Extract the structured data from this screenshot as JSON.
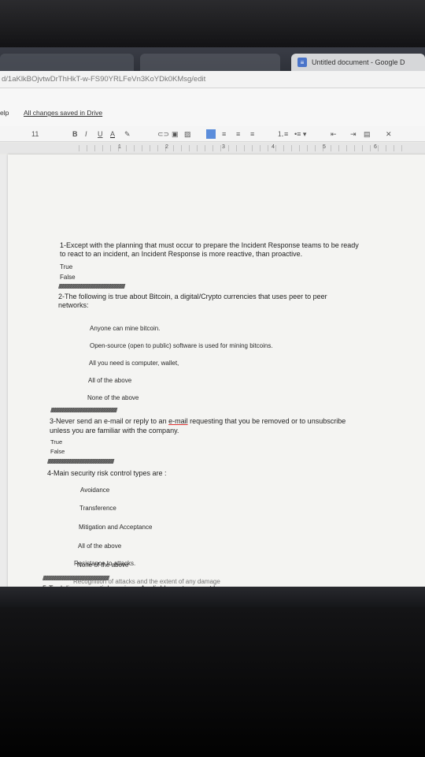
{
  "browser": {
    "active_tab_title": "Untitled document - Google D",
    "url": "d/1aKlkBOjvtwDrThHkT-w-FS90YRLFeVn3KoYDk0KMsg/edit"
  },
  "menubar": {
    "help": "elp",
    "saved_status": "All changes saved in Drive"
  },
  "toolbar": {
    "font_size": "11",
    "bold": "B",
    "italic": "I",
    "underline": "U",
    "text_color": "A"
  },
  "ruler": {
    "marks": [
      "1",
      "2",
      "3",
      "4",
      "5",
      "6"
    ]
  },
  "document": {
    "q1": {
      "line1": "1-Except with the planning that must occur to prepare the Incident Response teams to be ready",
      "line2": "to react to an incident, an Incident Response is more reactive, than proactive.",
      "options": [
        "True",
        "False"
      ]
    },
    "separator": "////////////////////////////////////////////////////////////////////////////////////////////////////////////////////",
    "q2": {
      "line1": "2-The following is true about Bitcoin, a digital/Crypto currencies that uses peer to peer",
      "line2": "networks:",
      "options": [
        "Anyone can mine bitcoin.",
        "Open-source (open to public) software is used for mining bitcoins.",
        "All you need is computer, wallet,",
        "All of the above",
        "None of the above"
      ]
    },
    "q3": {
      "line1_pre": "3-Never send an e-mail or reply to an ",
      "line1_link": "e-mail",
      "line1_post": " requesting that you be removed or to unsubscribe",
      "line2": "unless you are familiar with the company.",
      "options": [
        "True",
        "False"
      ]
    },
    "q4": {
      "line1": "4-Main security risk control types are :",
      "options": [
        "Avoidance",
        "Transference",
        "Mitigation and Acceptance",
        "All of the above",
        "None of the above"
      ]
    },
    "q5": {
      "line1": "5-To deliver essential services, A reliable system must have:",
      "options": [
        "Resistance to attacks.",
        "Recognition of attacks and the extent of any damage"
      ]
    }
  },
  "colors": {
    "accent": "#4a74c9",
    "page": "#f4f4f2"
  }
}
